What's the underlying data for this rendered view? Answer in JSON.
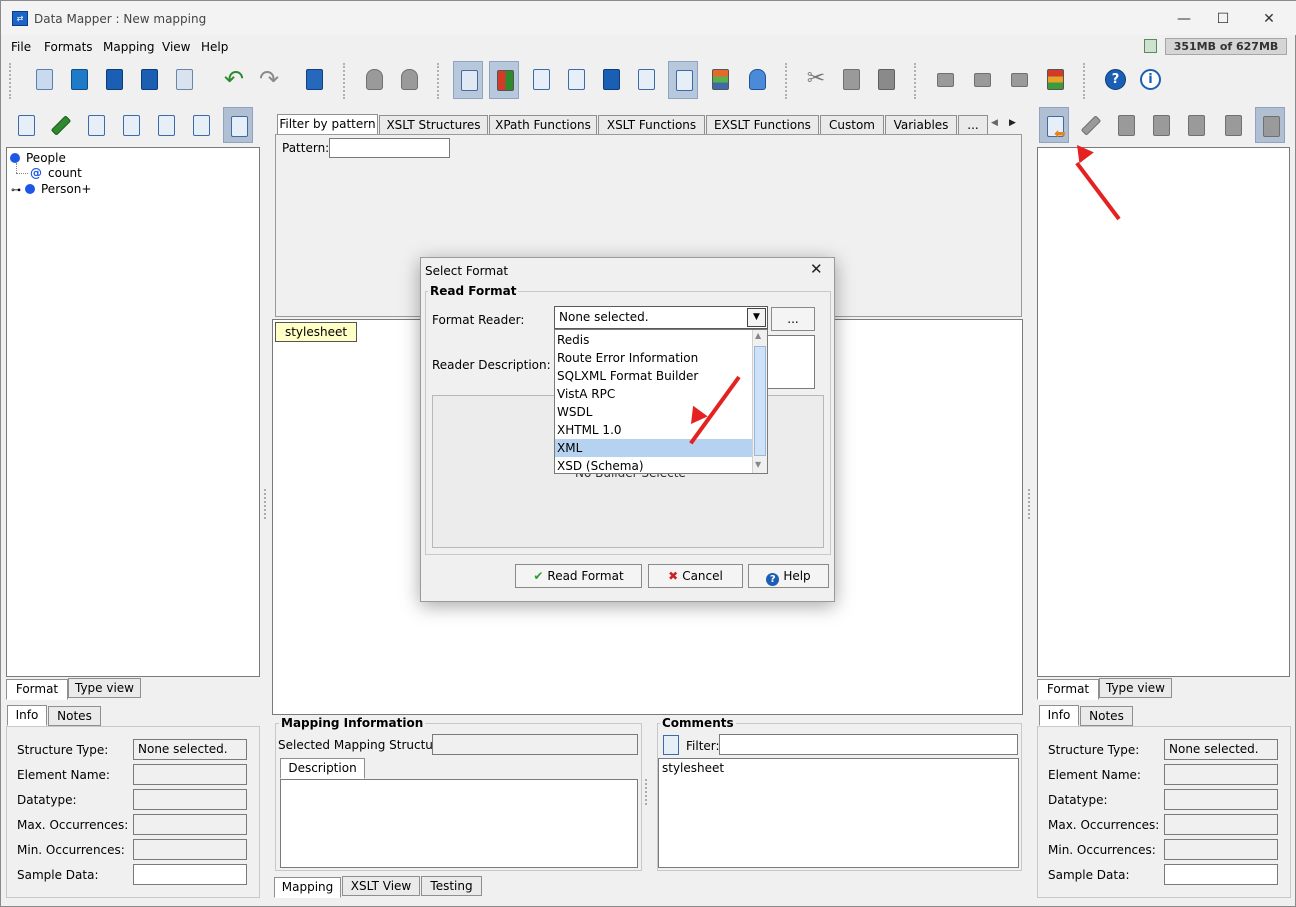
{
  "window": {
    "title": "Data Mapper : New mapping",
    "controls": {
      "minimize": "—",
      "maximize": "☐",
      "close": "✕"
    }
  },
  "menu": {
    "items": [
      "File",
      "Formats",
      "Mapping",
      "View",
      "Help"
    ]
  },
  "memory": "351MB of 627MB",
  "source_tree": {
    "root": "People",
    "children": [
      {
        "label": "count",
        "icon": "@"
      },
      {
        "label": "Person+",
        "icon": "dot"
      }
    ]
  },
  "left_bottom_tabs": {
    "format": "Format",
    "type_view": "Type view"
  },
  "info_tabs": {
    "info": "Info",
    "notes": "Notes"
  },
  "info_labels": {
    "structure_type": "Structure Type:",
    "element_name": "Element Name:",
    "datatype": "Datatype:",
    "max_occ": "Max. Occurrences:",
    "min_occ": "Min. Occurrences:",
    "sample_data": "Sample Data:"
  },
  "info_values": {
    "structure_type": "None selected."
  },
  "function_tabs": [
    "Filter by pattern",
    "XSLT Structures",
    "XPath Functions",
    "XSLT Functions",
    "EXSLT Functions",
    "Custom",
    "Variables",
    "..."
  ],
  "pattern_label": "Pattern:",
  "stylesheet_node": "stylesheet",
  "mapping_info": {
    "title": "Mapping Information",
    "selected_label": "Selected Mapping Structure:",
    "description_tab": "Description"
  },
  "comments": {
    "title": "Comments",
    "filter_label": "Filter:",
    "text": "stylesheet"
  },
  "center_bottom_tabs": [
    "Mapping",
    "XSLT View",
    "Testing"
  ],
  "dialog": {
    "title": "Select Format",
    "group_title": "Read Format",
    "format_reader_label": "Format Reader:",
    "format_reader_value": "None selected.",
    "browse_label": "...",
    "reader_desc_label": "Reader Description:",
    "partial_text": "No Builder Selected",
    "options": [
      "Redis",
      "Route Error Information",
      "SQLXML Format Builder",
      "VistA RPC",
      "WSDL",
      "XHTML 1.0",
      "XML",
      "XSD (Schema)"
    ],
    "selected_option": "XML",
    "read_button": "Read Format",
    "cancel_button": "Cancel",
    "help_button": "Help"
  },
  "colors": {
    "accent_blue": "#1e57e6",
    "arrow_red": "#e52121",
    "selection": "#b5d3f0",
    "stylesheet_bg": "#ffffc6"
  }
}
